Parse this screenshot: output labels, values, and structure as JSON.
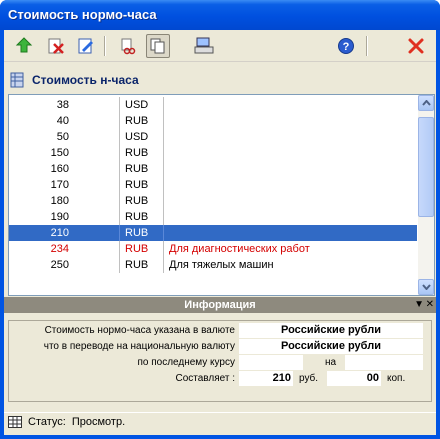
{
  "window": {
    "title": "Стоимость нормо-часа"
  },
  "toolbar": {
    "buttons": [
      {
        "icon": "add-green-arrow-icon"
      },
      {
        "icon": "delete-red-x-icon"
      },
      {
        "icon": "edit-pencil-icon"
      },
      {
        "icon": "cut-icon"
      },
      {
        "icon": "copy-icon"
      },
      {
        "icon": "keyboard-icon"
      },
      {
        "icon": "help-icon"
      },
      {
        "icon": "close-red-x-icon"
      }
    ]
  },
  "caption": {
    "text": "Стоимость н-часа"
  },
  "rows": [
    {
      "value": "38",
      "currency": "USD",
      "note": ""
    },
    {
      "value": "40",
      "currency": "RUB",
      "note": ""
    },
    {
      "value": "50",
      "currency": "USD",
      "note": ""
    },
    {
      "value": "150",
      "currency": "RUB",
      "note": ""
    },
    {
      "value": "160",
      "currency": "RUB",
      "note": ""
    },
    {
      "value": "170",
      "currency": "RUB",
      "note": ""
    },
    {
      "value": "180",
      "currency": "RUB",
      "note": ""
    },
    {
      "value": "190",
      "currency": "RUB",
      "note": ""
    },
    {
      "value": "210",
      "currency": "RUB",
      "note": "",
      "selected": true
    },
    {
      "value": "234",
      "currency": "RUB",
      "note": "Для диагностических работ",
      "highlight": true
    },
    {
      "value": "250",
      "currency": "RUB",
      "note": "Для тяжелых машин"
    }
  ],
  "colors": {
    "selection": "#316ac5",
    "highlight_text": "#d40000",
    "titlebar": "#0054e3"
  },
  "info": {
    "header": "Информация",
    "label_currency": "Стоимость нормо-часа указана в валюте",
    "value_currency": "Российские рубли",
    "label_national": "что в переводе на национальную валюту",
    "value_national": "Российские рубли",
    "label_rate": "по последнему курсу",
    "label_on": "на",
    "label_total": "Составляет :",
    "rubles": "210",
    "rub_unit": "руб.",
    "kopecks": "00",
    "kop_unit": "коп."
  },
  "status": {
    "label": "Статус:",
    "value": "Просмотр."
  }
}
